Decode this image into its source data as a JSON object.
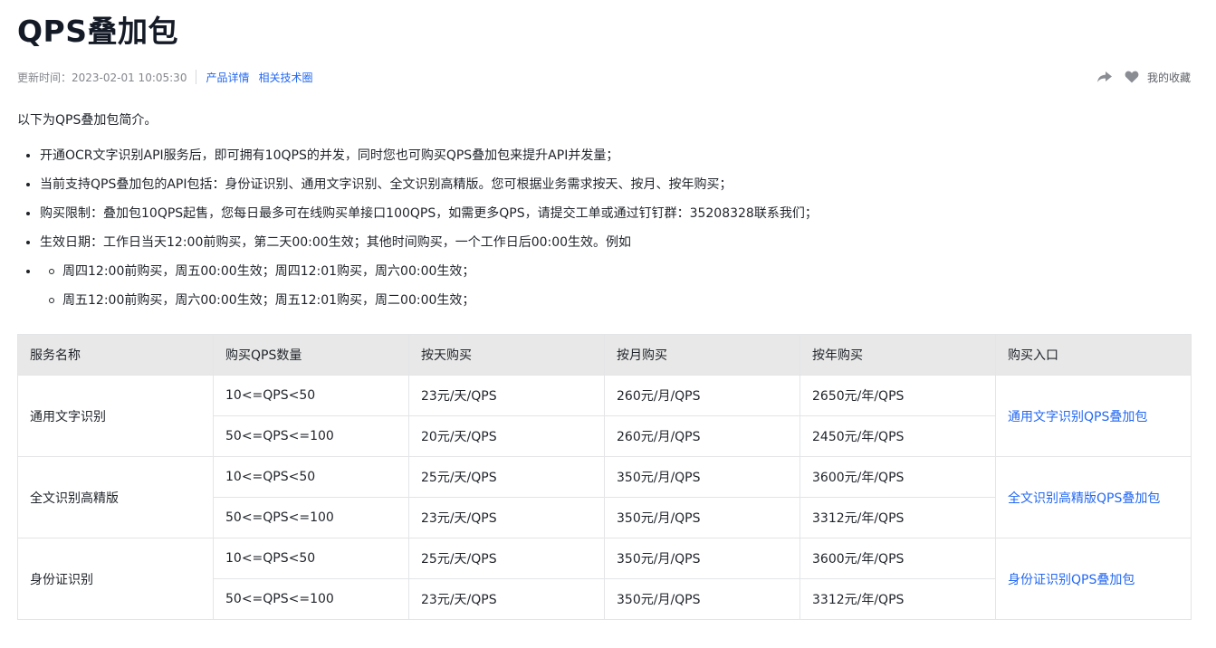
{
  "title": "QPS叠加包",
  "meta": {
    "updated": "更新时间：2023-02-01 10:05:30",
    "links": [
      "产品详情",
      "相关技术圈"
    ]
  },
  "actions": {
    "favorite_label": "我的收藏"
  },
  "intro": "以下为QPS叠加包简介。",
  "bullets": [
    "开通OCR文字识别API服务后，即可拥有10QPS的并发，同时您也可购买QPS叠加包来提升API并发量；",
    "当前支持QPS叠加包的API包括：身份证识别、通用文字识别、全文识别高精版。您可根据业务需求按天、按月、按年购买；",
    "购买限制：叠加包10QPS起售，您每日最多可在线购买单接口100QPS，如需更多QPS，请提交工单或通过钉钉群：35208328联系我们；",
    "生效日期：工作日当天12:00前购买，第二天00:00生效；其他时间购买，一个工作日后00:00生效。例如"
  ],
  "sub_bullets": [
    "周四12:00前购买，周五00:00生效；周四12:01购买，周六00:00生效；",
    "周五12:00前购买，周六00:00生效；周五12:01购买，周二00:00生效；"
  ],
  "table": {
    "headers": [
      "服务名称",
      "购买QPS数量",
      "按天购买",
      "按月购买",
      "按年购买",
      "购买入口"
    ],
    "groups": [
      {
        "service": "通用文字识别",
        "link": "通用文字识别QPS叠加包",
        "rows": [
          [
            "10<=QPS<50",
            "23元/天/QPS",
            "260元/月/QPS",
            "2650元/年/QPS"
          ],
          [
            "50<=QPS<=100",
            "20元/天/QPS",
            "260元/月/QPS",
            "2450元/年/QPS"
          ]
        ]
      },
      {
        "service": "全文识别高精版",
        "link": "全文识别高精版QPS叠加包",
        "rows": [
          [
            "10<=QPS<50",
            "25元/天/QPS",
            "350元/月/QPS",
            "3600元/年/QPS"
          ],
          [
            "50<=QPS<=100",
            "23元/天/QPS",
            "350元/月/QPS",
            "3312元/年/QPS"
          ]
        ]
      },
      {
        "service": "身份证识别",
        "link": "身份证识别QPS叠加包",
        "rows": [
          [
            "10<=QPS<50",
            "25元/天/QPS",
            "350元/月/QPS",
            "3600元/年/QPS"
          ],
          [
            "50<=QPS<=100",
            "23元/天/QPS",
            "350元/月/QPS",
            "3312元/年/QPS"
          ]
        ]
      }
    ]
  }
}
